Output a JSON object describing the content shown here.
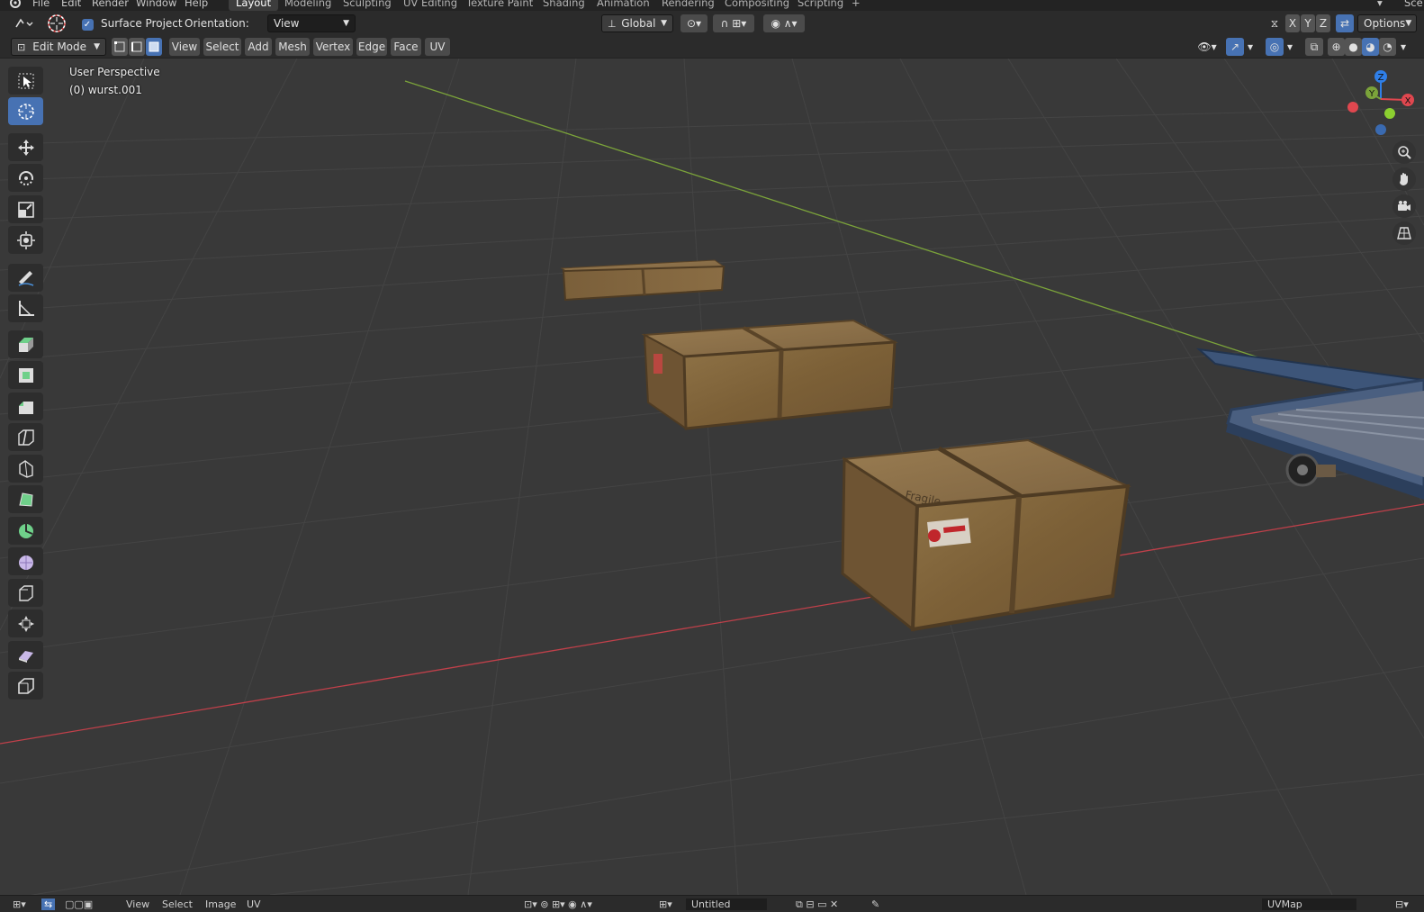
{
  "topbar": {
    "menus": [
      "File",
      "Edit",
      "Render",
      "Window",
      "Help"
    ],
    "workspace_tabs": [
      "Layout",
      "Modeling",
      "Sculpting",
      "UV Editing",
      "Texture Paint",
      "Shading",
      "Animation",
      "Rendering",
      "Compositing",
      "Scripting"
    ],
    "active_tab": "Layout",
    "scene_label": "Sce"
  },
  "tool_header": {
    "surface_project_label": "Surface Project",
    "surface_project_checked": true,
    "orientation_label": "Orientation:",
    "orientation_value": "View",
    "transform_orientation": "Global",
    "axis_x": "X",
    "axis_y": "Y",
    "axis_z": "Z",
    "options_label": "Options"
  },
  "view_header": {
    "mode": "Edit Mode",
    "menus": [
      "View",
      "Select",
      "Add",
      "Mesh",
      "Vertex",
      "Edge",
      "Face",
      "UV"
    ]
  },
  "viewport": {
    "perspective_label": "User Perspective",
    "object_label": "(0) wurst.001",
    "crate_label": "Fragile",
    "axis_x_color": "#e0474f",
    "axis_y_color": "#7ba33a",
    "axis_z_color": "#2f7fe8",
    "gizmo_x": "X",
    "gizmo_y": "Y",
    "gizmo_z": "Z"
  },
  "bottombar": {
    "menus": [
      "View",
      "Select",
      "Image",
      "UV"
    ],
    "image_name": "Untitled",
    "uvmap": "UVMap"
  },
  "colors": {
    "accent": "#4772b3",
    "background": "#393939",
    "header": "#2b2b2b"
  }
}
